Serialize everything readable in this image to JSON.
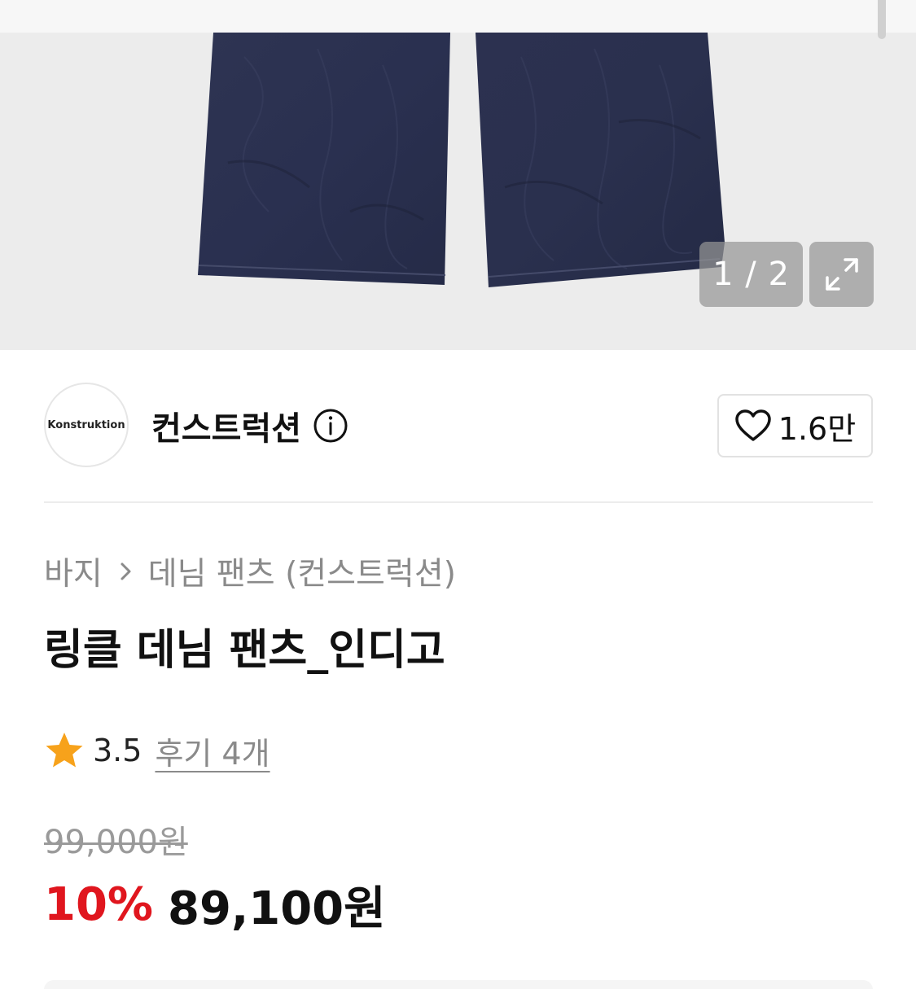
{
  "gallery": {
    "counter": "1 / 2",
    "expand_icon": "expand-icon"
  },
  "brand": {
    "logo_text": "Konstruktion",
    "name": "컨스트럭션",
    "info_icon": "info-icon",
    "like_count": "1.6만",
    "like_icon": "heart-icon"
  },
  "breadcrumb": {
    "category": "바지",
    "separator_icon": "chevron-right-icon",
    "subcategory": "데님 팬츠 (컨스트럭션)"
  },
  "product": {
    "title": "링클 데님 팬츠_인디고"
  },
  "rating": {
    "star_icon": "star-icon",
    "value": "3.5",
    "reviews": "후기 4개"
  },
  "price": {
    "original": "99,000원",
    "discount": "10%",
    "final": "89,100원"
  },
  "colors": {
    "discount": "#e0161e",
    "star": "#f7a21b",
    "denim": "#2b3150"
  }
}
